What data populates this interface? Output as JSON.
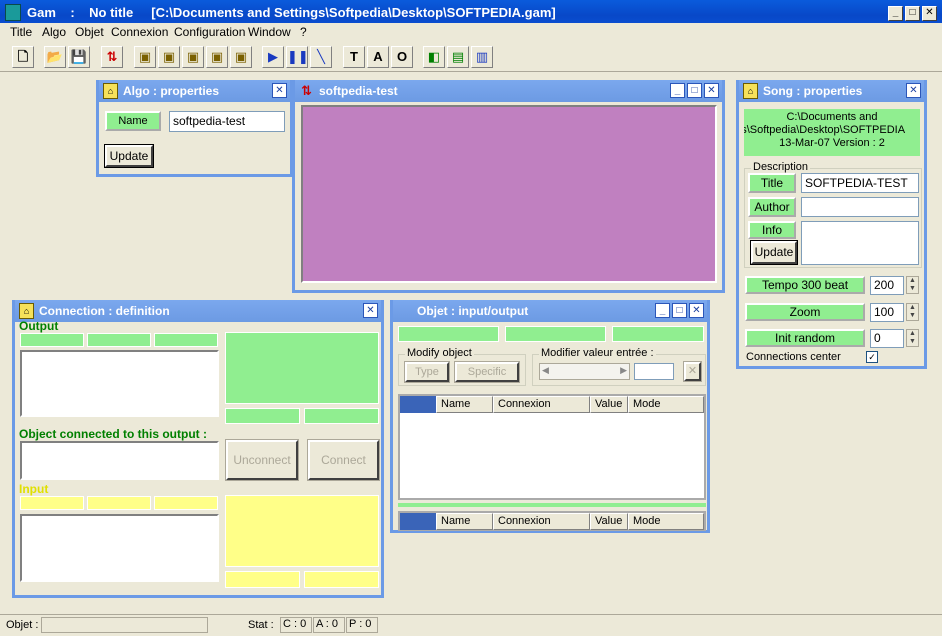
{
  "app": {
    "title": "Gam    :    No title     [C:\\Documents and Settings\\Softpedia\\Desktop\\SOFTPEDIA.gam]",
    "icon": "gam-app-icon"
  },
  "window_controls": {
    "minimize": "_",
    "maximize": "□",
    "close": "✕"
  },
  "menu": [
    "Title",
    "Algo",
    "Objet",
    "Connexion",
    "Configuration",
    "Window",
    "?"
  ],
  "toolbar": {
    "items": [
      {
        "name": "new-file-icon",
        "glyph": "🗋"
      },
      {
        "name": "open-folder-icon",
        "glyph": "📂"
      },
      {
        "name": "save-disk-icon",
        "glyph": "💾"
      },
      {
        "name": "arrows-updown-icon",
        "glyph": "⇅"
      },
      {
        "name": "algo-icon-1",
        "glyph": "▣"
      },
      {
        "name": "algo-icon-2",
        "glyph": "▣"
      },
      {
        "name": "algo-icon-3",
        "glyph": "▣"
      },
      {
        "name": "algo-icon-4",
        "glyph": "▣"
      },
      {
        "name": "algo-icon-5",
        "glyph": "▣"
      },
      {
        "name": "play-icon",
        "glyph": "▶"
      },
      {
        "name": "pause-icon",
        "glyph": "❚❚"
      },
      {
        "name": "line-tool-icon",
        "glyph": "╲"
      },
      {
        "name": "text-tool-icon",
        "glyph": "T"
      },
      {
        "name": "a-tool-icon",
        "glyph": "A"
      },
      {
        "name": "o-tool-icon",
        "glyph": "O"
      },
      {
        "name": "layers-icon",
        "glyph": "◧"
      },
      {
        "name": "split-horizontal-icon",
        "glyph": "▤"
      },
      {
        "name": "split-vertical-icon",
        "glyph": "▥"
      }
    ]
  },
  "algo_props": {
    "title": "Algo : properties",
    "name_label": "Name",
    "name_value": "softpedia-test",
    "update_label": "Update"
  },
  "canvas_win": {
    "title": "softpedia-test",
    "canvas_color": "#c080c0"
  },
  "song_props": {
    "title": "Song : properties",
    "path_lines": [
      "C:\\Documents and",
      "ngs\\Softpedia\\Desktop\\SOFTPEDIA",
      "13-Mar-07   Version : 2"
    ],
    "description_label": "Description",
    "title_label": "Title",
    "title_value": "SOFTPEDIA-TEST",
    "author_label": "Author",
    "author_value": "",
    "info_label": "Info",
    "info_value": "",
    "update_label": "Update",
    "tempo_label": "Tempo 300 beat",
    "tempo_value": "200",
    "zoom_label": "Zoom",
    "zoom_value": "100",
    "init_random_label": "Init random",
    "init_random_value": "0",
    "connections_center_label": "Connections center",
    "connections_center_checked": "✓"
  },
  "connection_def": {
    "title": "Connection : definition",
    "output_label": "Output",
    "connected_label": "Object connected to this output :",
    "input_label": "Input",
    "unconnect_label": "Unconnect",
    "connect_label": "Connect"
  },
  "objet_io": {
    "title": "Objet : input/output",
    "modify_object_label": "Modify object",
    "type_label": "Type",
    "specific_label": "Specific",
    "modifier_label": "Modifier valeur entrée :",
    "columns": [
      "Name",
      "Connexion",
      "Value",
      "Mode"
    ]
  },
  "status": {
    "objet_label": "Objet :",
    "stat_label": "Stat :",
    "c_value": "C : 0",
    "a_value": "A : 0",
    "p_value": "P : 0"
  },
  "colors": {
    "green": "#90ee90",
    "yellow": "#ffff88",
    "canvas": "#c080c0",
    "caption": "#6c9ae3",
    "title_blue": "#0848c8"
  }
}
